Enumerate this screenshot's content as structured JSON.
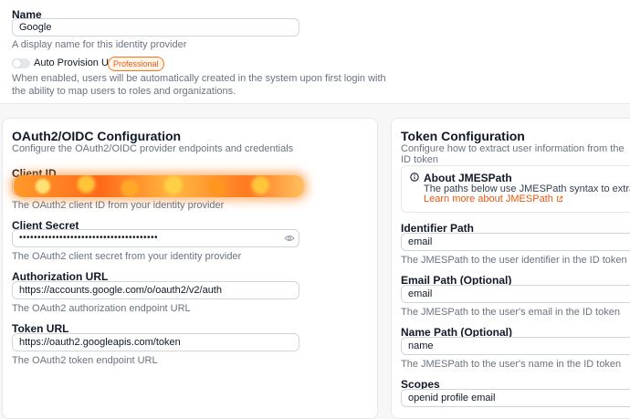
{
  "general": {
    "name_label": "Name",
    "name_value": "Google",
    "name_help": "A display name for this identity provider",
    "auto_provision_label": "Auto Provision Users",
    "auto_provision_badge": "Professional",
    "auto_provision_enabled": false,
    "auto_provision_help_line1": "When enabled, users will be automatically created in the system upon first login with",
    "auto_provision_help_line2": "the ability to map users to roles and organizations."
  },
  "oauth": {
    "title": "OAuth2/OIDC Configuration",
    "subtitle": "Configure the OAuth2/OIDC provider endpoints and credentials",
    "client_id_label": "Client ID",
    "client_id_help": "The OAuth2 client ID from your identity provider",
    "client_secret_label": "Client Secret",
    "client_secret_value": "••••••••••••••••••••••••••••••••••••••",
    "client_secret_help": "The OAuth2 client secret from your identity provider",
    "auth_url_label": "Authorization URL",
    "auth_url_value": "https://accounts.google.com/o/oauth2/v2/auth",
    "auth_url_help": "The OAuth2 authorization endpoint URL",
    "token_url_label": "Token URL",
    "token_url_value": "https://oauth2.googleapis.com/token",
    "token_url_help": "The OAuth2 token endpoint URL"
  },
  "token": {
    "title": "Token Configuration",
    "subtitle": "Configure how to extract user information from the ID token",
    "jmes_title": "About JMESPath",
    "jmes_text": "The paths below use JMESPath syntax to extract values from t",
    "jmes_link": "Learn more about JMESPath",
    "identifier_label": "Identifier Path",
    "identifier_value": "email",
    "identifier_help": "The JMESPath to the user identifier in the ID token",
    "email_label": "Email Path (Optional)",
    "email_value": "email",
    "email_help": "The JMESPath to the user's email in the ID token",
    "name_label": "Name Path (Optional)",
    "name_value": "name",
    "name_help": "The JMESPath to the user's name in the ID token",
    "scopes_label": "Scopes",
    "scopes_value": "openid profile email"
  },
  "colors": {
    "accent": "#ea580c",
    "border": "#e5e7eb",
    "muted_text": "#6b7280"
  }
}
